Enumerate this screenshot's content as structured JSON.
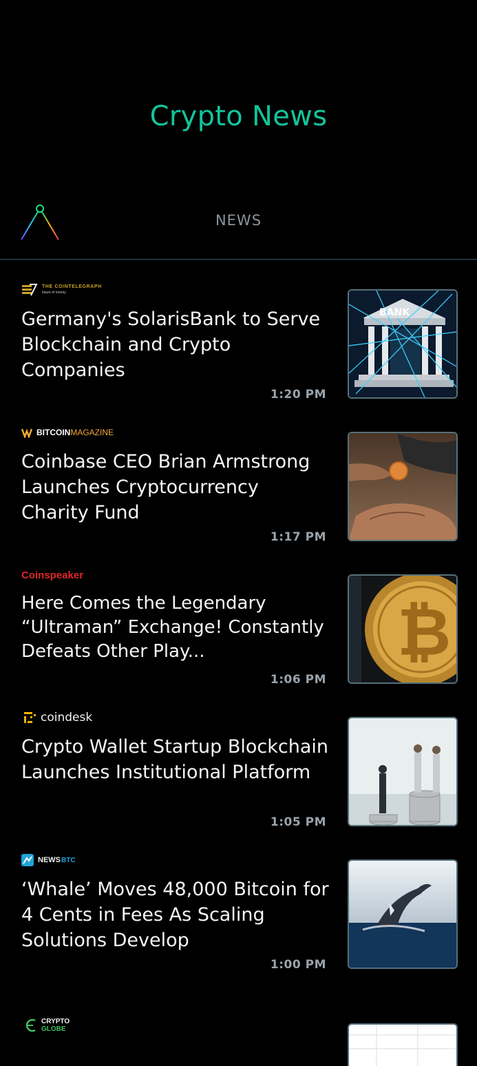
{
  "header": {
    "title": "Crypto News"
  },
  "nav": {
    "tab": "NEWS"
  },
  "feed": [
    {
      "source": "THE COINTELEGRAPH",
      "source_sub": "future of money",
      "headline": "Germany's SolarisBank to Serve Blockchain and Crypto Companies",
      "time": "1:20 PM",
      "thumb_label": "BANK"
    },
    {
      "source_a": "BITCOIN",
      "source_b": "MAGAZINE",
      "headline": "Coinbase CEO Brian Armstrong Launches Cryptocurrency Charity Fund",
      "time": "1:17 PM"
    },
    {
      "source": "Coinspeaker",
      "headline": "Here Comes the Legendary “Ultraman” Exchange! Constantly Defeats Other Play...",
      "time": "1:06 PM"
    },
    {
      "source": "coindesk",
      "headline": "Crypto Wallet Startup Blockchain Launches Institutional Platform",
      "time": "1:05 PM"
    },
    {
      "source_a": "NEWS",
      "source_b": "BTC",
      "headline": "‘Whale’ Moves 48,000 Bitcoin for 4 Cents in Fees As Scaling Solutions Develop",
      "time": "1:00 PM"
    },
    {
      "source_a": "CRYPTO",
      "source_b": "GLOBE"
    }
  ],
  "colors": {
    "accent": "#13c49b",
    "background": "#000000",
    "tab_text": "#8a949c",
    "time_text": "#9aa3ab",
    "coinspeaker_red": "#e0262b",
    "bitcoinmagazine_orange": "#f2a93b",
    "newsbtc_blue": "#1fa3d8"
  }
}
